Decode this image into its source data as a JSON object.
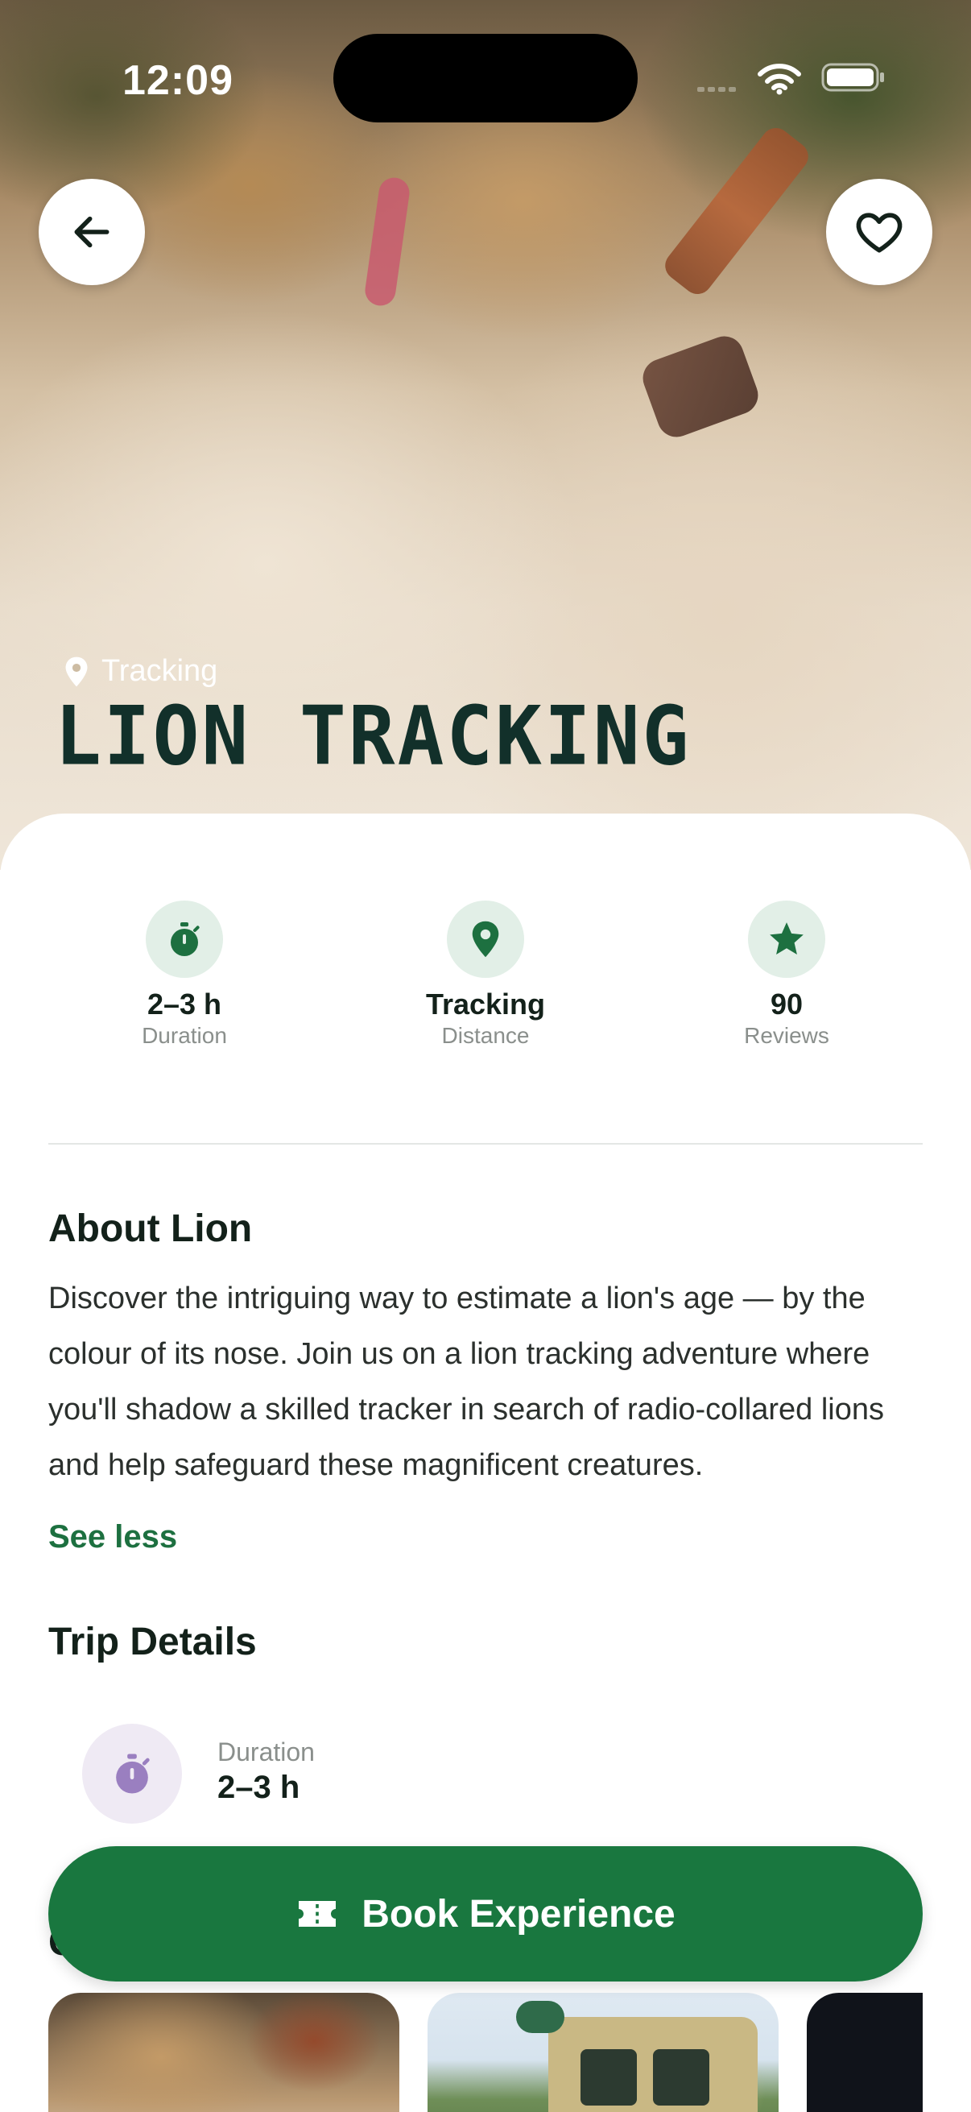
{
  "status_bar": {
    "time": "12:09"
  },
  "hero": {
    "category": "Tracking",
    "title": "LION TRACKING"
  },
  "stats": [
    {
      "icon": "stopwatch-icon",
      "value": "2–3 h",
      "label": "Duration"
    },
    {
      "icon": "map-pin-icon",
      "value": "Tracking",
      "label": "Distance"
    },
    {
      "icon": "star-icon",
      "value": "90",
      "label": "Reviews"
    }
  ],
  "about": {
    "heading": "About Lion",
    "text": "Discover the intriguing way to estimate a lion's age — by the colour of its nose. Join us on a lion tracking adventure where you'll shadow a skilled tracker in search of radio-collared lions and help safeguard these magnificent creatures.",
    "toggle_label": "See less"
  },
  "trip_details": {
    "heading": "Trip Details",
    "items": [
      {
        "icon": "stopwatch-icon",
        "label": "Duration",
        "value": "2–3 h"
      }
    ]
  },
  "cta": {
    "icon": "ticket-icon",
    "label": "Book Experience"
  },
  "colors": {
    "accent_green": "#19773f",
    "stat_icon_bg": "#e2efe7",
    "detail_icon_bg": "#efeaf4",
    "detail_icon_fg": "#9a7fc0"
  }
}
